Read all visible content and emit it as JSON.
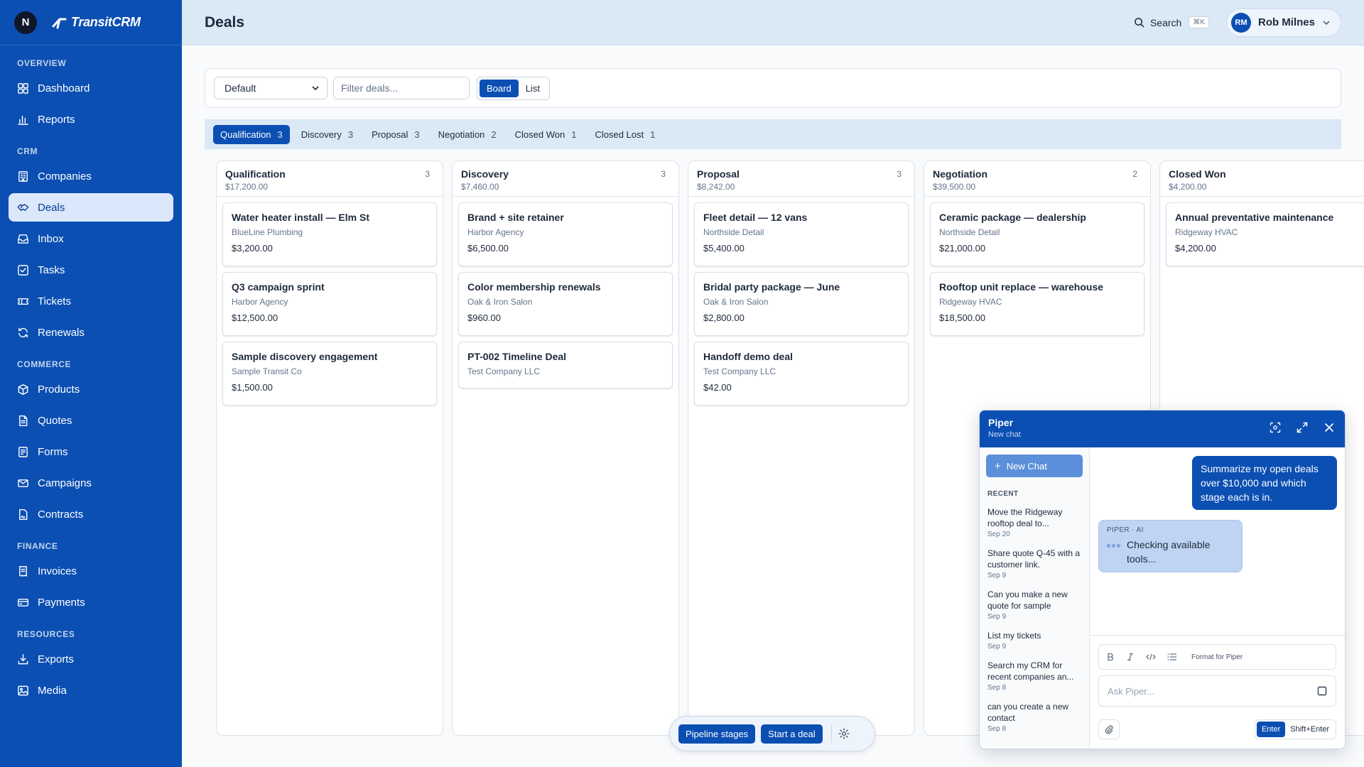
{
  "app": {
    "workspace_initial": "N",
    "logo_text": "TransitCRM",
    "page_title": "Deals"
  },
  "sidebar": {
    "sections": [
      {
        "label": "OVERVIEW",
        "items": [
          {
            "label": "Dashboard",
            "icon": "grid-icon"
          },
          {
            "label": "Reports",
            "icon": "bar-chart-icon"
          }
        ]
      },
      {
        "label": "CRM",
        "items": [
          {
            "label": "Companies",
            "icon": "building-icon"
          },
          {
            "label": "Deals",
            "icon": "handshake-icon",
            "active": true
          },
          {
            "label": "Inbox",
            "icon": "inbox-icon"
          },
          {
            "label": "Tasks",
            "icon": "checkbox-icon"
          },
          {
            "label": "Tickets",
            "icon": "ticket-icon"
          },
          {
            "label": "Renewals",
            "icon": "refresh-icon"
          }
        ]
      },
      {
        "label": "COMMERCE",
        "items": [
          {
            "label": "Products",
            "icon": "package-icon"
          },
          {
            "label": "Quotes",
            "icon": "file-icon"
          },
          {
            "label": "Forms",
            "icon": "form-icon"
          },
          {
            "label": "Campaigns",
            "icon": "mail-icon"
          },
          {
            "label": "Contracts",
            "icon": "contract-icon"
          }
        ]
      },
      {
        "label": "FINANCE",
        "items": [
          {
            "label": "Invoices",
            "icon": "receipt-icon"
          },
          {
            "label": "Payments",
            "icon": "credit-card-icon"
          }
        ]
      },
      {
        "label": "RESOURCES",
        "items": [
          {
            "label": "Exports",
            "icon": "download-icon"
          },
          {
            "label": "Media",
            "icon": "image-icon"
          }
        ]
      }
    ]
  },
  "topbar": {
    "search_label": "Search",
    "search_shortcut": "⌘K",
    "user_initials": "RM",
    "user_name": "Rob Milnes"
  },
  "filters": {
    "view_selected": "Default",
    "filter_placeholder": "Filter deals...",
    "board_label": "Board",
    "list_label": "List"
  },
  "stage_tabs": [
    {
      "label": "Qualification",
      "count": "3",
      "active": true
    },
    {
      "label": "Discovery",
      "count": "3"
    },
    {
      "label": "Proposal",
      "count": "3"
    },
    {
      "label": "Negotiation",
      "count": "2"
    },
    {
      "label": "Closed Won",
      "count": "1"
    },
    {
      "label": "Closed Lost",
      "count": "1"
    }
  ],
  "columns": [
    {
      "title": "Qualification",
      "total": "$17,200.00",
      "count": "3",
      "cards": [
        {
          "title": "Water heater install — Elm St",
          "company": "BlueLine Plumbing",
          "amount": "$3,200.00"
        },
        {
          "title": "Q3 campaign sprint",
          "company": "Harbor Agency",
          "amount": "$12,500.00"
        },
        {
          "title": "Sample discovery engagement",
          "company": "Sample Transit Co",
          "amount": "$1,500.00"
        }
      ]
    },
    {
      "title": "Discovery",
      "total": "$7,460.00",
      "count": "3",
      "cards": [
        {
          "title": "Brand + site retainer",
          "company": "Harbor Agency",
          "amount": "$6,500.00"
        },
        {
          "title": "Color membership renewals",
          "company": "Oak & Iron Salon",
          "amount": "$960.00"
        },
        {
          "title": "PT-002 Timeline Deal",
          "company": "Test Company LLC",
          "amount": ""
        }
      ]
    },
    {
      "title": "Proposal",
      "total": "$8,242.00",
      "count": "3",
      "cards": [
        {
          "title": "Fleet detail — 12 vans",
          "company": "Northside Detail",
          "amount": "$5,400.00"
        },
        {
          "title": "Bridal party package — June",
          "company": "Oak & Iron Salon",
          "amount": "$2,800.00"
        },
        {
          "title": "Handoff demo deal",
          "company": "Test Company LLC",
          "amount": "$42.00"
        }
      ]
    },
    {
      "title": "Negotiation",
      "total": "$39,500.00",
      "count": "2",
      "cards": [
        {
          "title": "Ceramic package — dealership",
          "company": "Northside Detail",
          "amount": "$21,000.00"
        },
        {
          "title": "Rooftop unit replace — warehouse",
          "company": "Ridgeway HVAC",
          "amount": "$18,500.00"
        }
      ]
    },
    {
      "title": "Closed Won",
      "total": "$4,200.00",
      "count": "",
      "cards": [
        {
          "title": "Annual preventative maintenance",
          "company": "Ridgeway HVAC",
          "amount": "$4,200.00"
        }
      ]
    }
  ],
  "bottom_bar": {
    "pipeline_label": "Pipeline stages",
    "start_label": "Start a deal"
  },
  "piper": {
    "title": "Piper",
    "subtitle": "New chat",
    "new_chat_label": "New Chat",
    "recent_label": "RECENT",
    "recent": [
      {
        "text": "Move the Ridgeway rooftop deal to...",
        "date": "Sep 20"
      },
      {
        "text": "Share quote Q-45 with a customer link.",
        "date": "Sep 9"
      },
      {
        "text": "Can you make a new quote for sample",
        "date": "Sep 9"
      },
      {
        "text": "List my tickets",
        "date": "Sep 9"
      },
      {
        "text": "Search my CRM for recent companies an...",
        "date": "Sep 8"
      },
      {
        "text": "can you create a new contact",
        "date": "Sep 8"
      }
    ],
    "user_message": "Summarize my open deals over $10,000 and which stage each is in.",
    "ai_label": "PIPER · AI",
    "ai_message": "Checking available tools...",
    "format_label": "Format for Piper",
    "ask_placeholder": "Ask Piper...",
    "enter_label": "Enter",
    "shift_enter_label": "Shift+Enter"
  }
}
